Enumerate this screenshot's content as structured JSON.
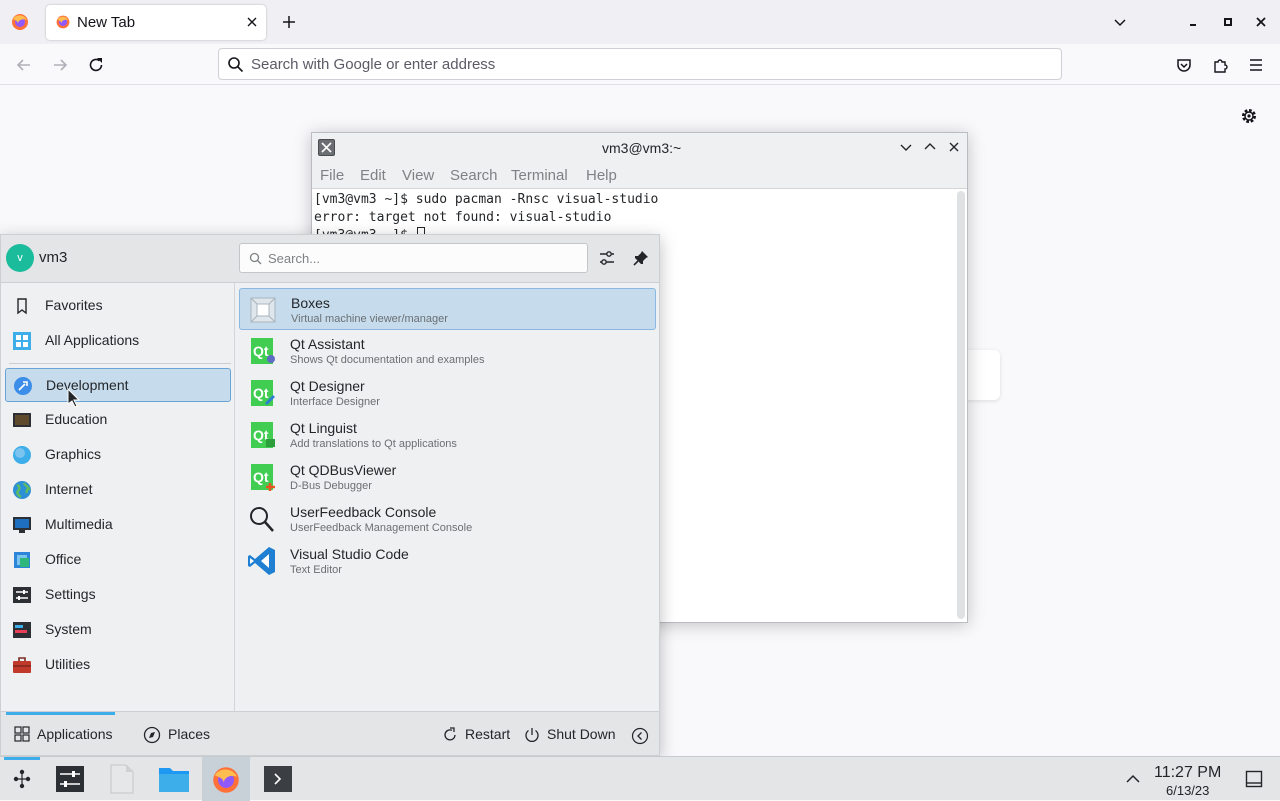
{
  "browser": {
    "tab_title": "New Tab",
    "url_placeholder": "Search with Google or enter address"
  },
  "terminal": {
    "title": "vm3@vm3:~",
    "menu": [
      "File",
      "Edit",
      "View",
      "Search",
      "Terminal",
      "Help"
    ],
    "lines": [
      "[vm3@vm3 ~]$ sudo pacman -Rnsc visual-studio",
      "error: target not found: visual-studio",
      "[vm3@vm3 ~]$ "
    ]
  },
  "launcher": {
    "user_initial": "v",
    "username": "vm3",
    "search_placeholder": "Search...",
    "categories": [
      {
        "label": "Favorites",
        "icon": "bookmark-icon"
      },
      {
        "label": "All Applications",
        "icon": "grid-icon"
      },
      {
        "label": "Development",
        "icon": "development-icon"
      },
      {
        "label": "Education",
        "icon": "education-icon"
      },
      {
        "label": "Graphics",
        "icon": "graphics-icon"
      },
      {
        "label": "Internet",
        "icon": "globe-icon"
      },
      {
        "label": "Multimedia",
        "icon": "multimedia-icon"
      },
      {
        "label": "Office",
        "icon": "office-icon"
      },
      {
        "label": "Settings",
        "icon": "settings-icon"
      },
      {
        "label": "System",
        "icon": "system-icon"
      },
      {
        "label": "Utilities",
        "icon": "toolbox-icon"
      }
    ],
    "apps": [
      {
        "name": "Boxes",
        "desc": "Virtual machine viewer/manager"
      },
      {
        "name": "Qt Assistant",
        "desc": "Shows Qt documentation and examples"
      },
      {
        "name": "Qt Designer",
        "desc": "Interface Designer"
      },
      {
        "name": "Qt Linguist",
        "desc": "Add translations to Qt applications"
      },
      {
        "name": "Qt QDBusViewer",
        "desc": "D-Bus Debugger"
      },
      {
        "name": "UserFeedback Console",
        "desc": "UserFeedback Management Console"
      },
      {
        "name": "Visual Studio Code",
        "desc": "Text Editor"
      }
    ],
    "qt_label": "Qt",
    "footer": {
      "applications": "Applications",
      "places": "Places",
      "restart": "Restart",
      "shutdown": "Shut Down"
    }
  },
  "clock": {
    "time": "11:27 PM",
    "date": "6/13/23"
  },
  "colors": {
    "accent": "#3daee9",
    "selection": "#c6dcec",
    "qt_green": "#41cd52",
    "vscode_blue": "#1f7fd2"
  }
}
